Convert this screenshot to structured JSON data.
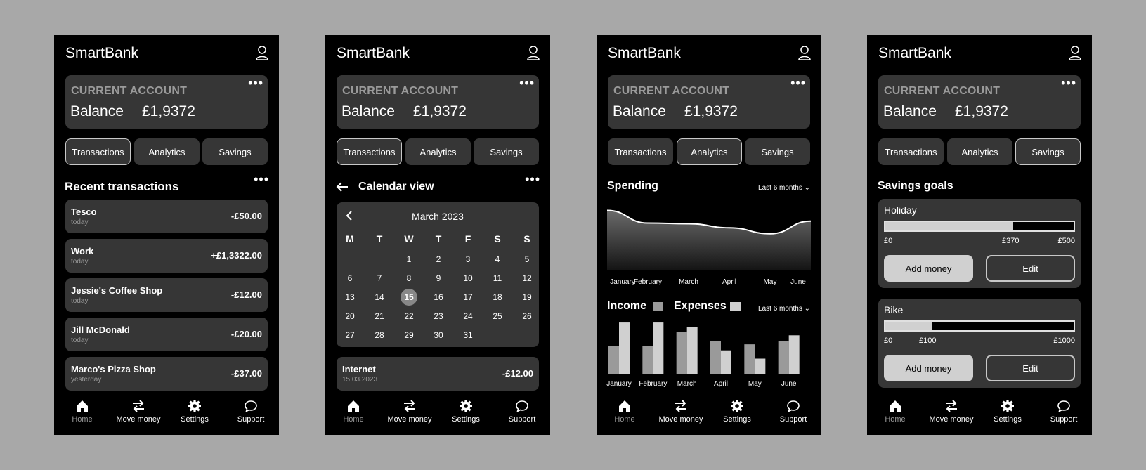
{
  "app": {
    "title": "SmartBank",
    "account_label": "CURRENT ACCOUNT",
    "balance_label": "Balance",
    "balance_value": "£1,9372"
  },
  "tabs": [
    "Transactions",
    "Analytics",
    "Savings"
  ],
  "nav": [
    "Home",
    "Move money",
    "Settings",
    "Support"
  ],
  "icons": [
    "user-icon",
    "more-icon",
    "home-icon",
    "swap-arrows-icon",
    "gear-icon",
    "chat-bubble-icon",
    "arrow-left-icon",
    "chevron-left-icon",
    "chevron-down-icon"
  ],
  "screens": [
    {
      "active_tab": "Transactions",
      "section_title": "Recent transactions",
      "transactions": [
        {
          "name": "Tesco",
          "date": "today",
          "amount": "-£50.00"
        },
        {
          "name": "Work",
          "date": "today",
          "amount": "+£1,3322.00"
        },
        {
          "name": "Jessie's Coffee Shop",
          "date": "today",
          "amount": "-£12.00"
        },
        {
          "name": "Jill McDonald",
          "date": "today",
          "amount": "-£20.00"
        },
        {
          "name": "Marco's Pizza Shop",
          "date": "yesterday",
          "amount": "-£37.00"
        }
      ]
    },
    {
      "active_tab": "Transactions",
      "section_title": "Calendar view",
      "calendar": {
        "month": "March 2023",
        "weekdays": [
          "M",
          "T",
          "W",
          "T",
          "F",
          "S",
          "S"
        ],
        "first_weekday_index": 2,
        "days_in_month": 31,
        "selected_day": 15
      },
      "entry": {
        "name": "Internet",
        "date": "15.03.2023",
        "amount": "-£12.00"
      }
    },
    {
      "active_tab": "Analytics",
      "spending_title": "Spending",
      "period_label": "Last 6 months",
      "months": [
        "January",
        "February",
        "March",
        "April",
        "May",
        "June"
      ],
      "income_label": "Income",
      "expenses_label": "Expenses",
      "colors": {
        "income": "#9a9a9a",
        "expenses": "#d0d0d0"
      }
    },
    {
      "active_tab": "Savings",
      "section_title": "Savings goals",
      "goals": [
        {
          "name": "Holiday",
          "min": "£0",
          "current": "£370",
          "max": "£500",
          "progress": 0.68,
          "add_label": "Add money",
          "edit_label": "Edit"
        },
        {
          "name": "Bike",
          "min": "£0",
          "current": "£100",
          "max": "£1000",
          "progress": 0.25,
          "add_label": "Add money",
          "edit_label": "Edit"
        }
      ]
    }
  ],
  "chart_data": [
    {
      "type": "area",
      "title": "Spending",
      "categories": [
        "January",
        "February",
        "March",
        "April",
        "May",
        "June"
      ],
      "values": [
        90,
        71,
        70,
        64,
        55,
        74
      ],
      "ylim": [
        0,
        100
      ]
    },
    {
      "type": "bar",
      "categories": [
        "January",
        "February",
        "March",
        "April",
        "May",
        "June"
      ],
      "series": [
        {
          "name": "Income",
          "values": [
            38,
            38,
            56,
            44,
            40,
            44
          ]
        },
        {
          "name": "Expenses",
          "values": [
            69,
            69,
            63,
            32,
            21,
            52
          ]
        }
      ],
      "ylim": [
        0,
        70
      ]
    }
  ]
}
